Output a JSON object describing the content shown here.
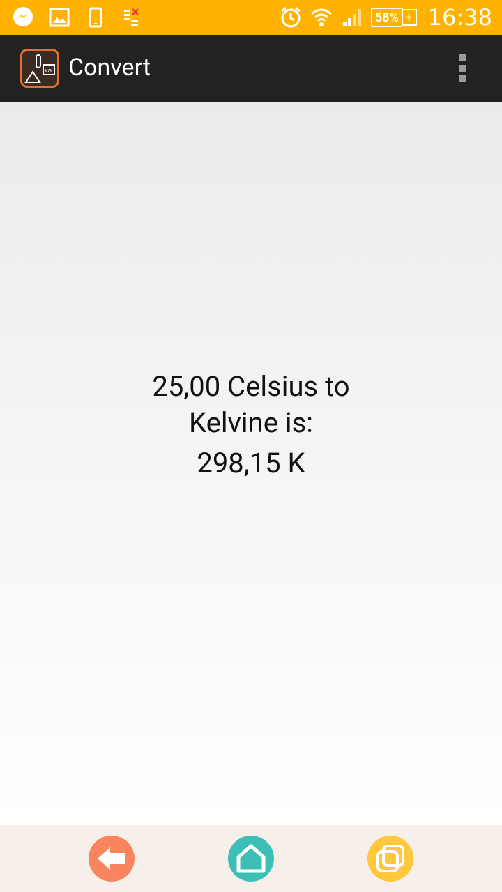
{
  "status_bar": {
    "left_icons": [
      "messenger-icon",
      "image-icon",
      "phone-icon",
      "data-icon"
    ],
    "right_icons": [
      "alarm-icon",
      "wifi-icon",
      "signal-icon"
    ],
    "battery": "58%",
    "time": "16:38",
    "color": "#FFB300"
  },
  "action_bar": {
    "title": "Convert",
    "menu_icon": "overflow-menu-icon",
    "color": "#222222"
  },
  "result": {
    "line1": "25,00 Celsius to",
    "line2": "Kelvine is:",
    "value": "298,15 K"
  },
  "bottom_nav": {
    "items": [
      {
        "name": "back-icon",
        "color": "#F9855E"
      },
      {
        "name": "home-icon",
        "color": "#3DBFB8"
      },
      {
        "name": "recent-apps-icon",
        "color": "#FFC83D"
      }
    ]
  }
}
